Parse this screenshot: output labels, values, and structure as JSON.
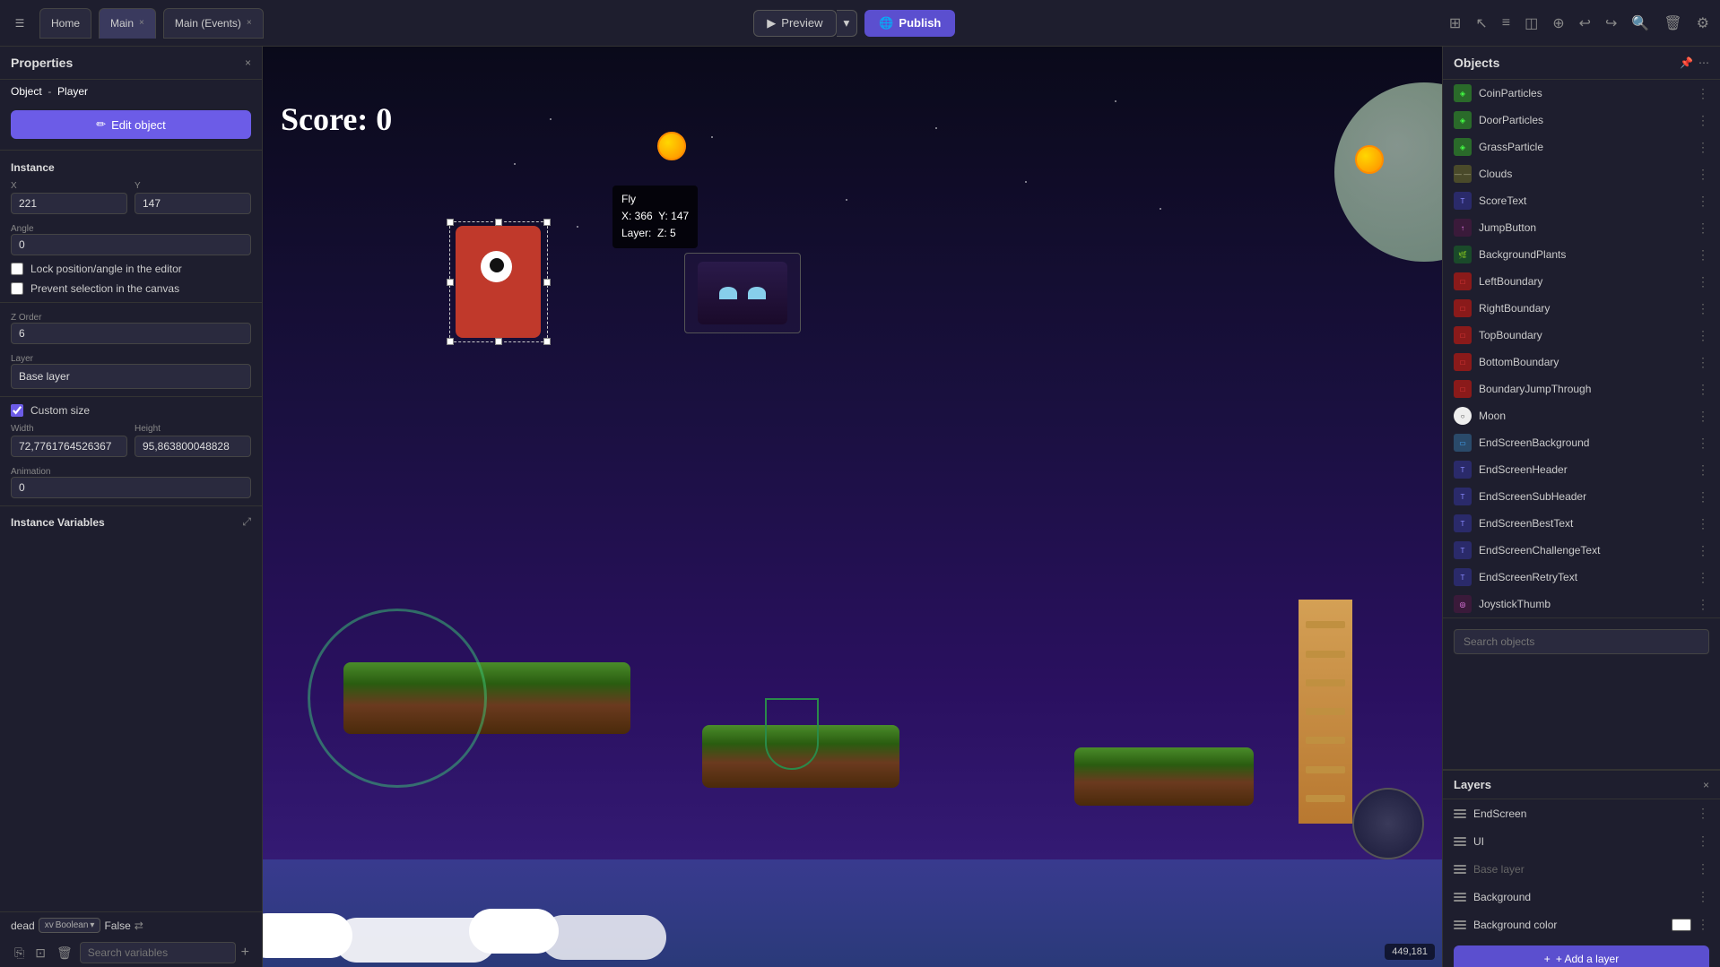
{
  "app": {
    "menu_icon": "☰",
    "tabs": [
      {
        "label": "Home",
        "closable": false,
        "active": false
      },
      {
        "label": "Main",
        "closable": true,
        "active": true
      },
      {
        "label": "Main (Events)",
        "closable": true,
        "active": false
      }
    ]
  },
  "toolbar": {
    "preview_label": "Preview",
    "preview_dropdown": "▾",
    "publish_label": "Publish",
    "icons": [
      "grid",
      "select",
      "list",
      "layers",
      "crosshair",
      "undo",
      "redo",
      "search",
      "trash",
      "settings"
    ]
  },
  "properties": {
    "title": "Properties",
    "object_prefix": "Object",
    "object_name": "Player",
    "edit_button": "Edit object",
    "instance_label": "Instance",
    "x_label": "X",
    "x_value": "221",
    "y_label": "Y",
    "y_value": "147",
    "angle_label": "Angle",
    "angle_value": "0",
    "lock_label": "Lock position/angle in the editor",
    "prevent_label": "Prevent selection in the canvas",
    "zorder_label": "Z Order",
    "zorder_value": "6",
    "layer_label": "Layer",
    "layer_value": "Base layer",
    "custom_size_label": "Custom size",
    "custom_size_checked": true,
    "width_label": "Width",
    "width_value": "72,7761764526367",
    "height_label": "Height",
    "height_value": "95,863800048828",
    "animation_label": "Animation",
    "animation_value": "0",
    "instance_vars_label": "Instance Variables",
    "var_name": "dead",
    "var_type": "Boolean",
    "var_value": "False",
    "search_vars_placeholder": "Search variables",
    "add_var_icon": "+"
  },
  "canvas": {
    "score": "Score: 0",
    "fly_popup": {
      "name": "Fly",
      "x": "X: 366",
      "y": "Y: 147",
      "layer": "Layer:",
      "z": "Z: 5"
    },
    "coords": "449,181"
  },
  "objects_panel": {
    "title": "Objects",
    "search_placeholder": "Search objects",
    "items": [
      {
        "name": "CoinParticles",
        "icon_type": "particle"
      },
      {
        "name": "DoorParticles",
        "icon_type": "particle"
      },
      {
        "name": "GrassParticle",
        "icon_type": "particle"
      },
      {
        "name": "Clouds",
        "icon_type": "dash"
      },
      {
        "name": "ScoreText",
        "icon_type": "text"
      },
      {
        "name": "JumpButton",
        "icon_type": "jump"
      },
      {
        "name": "BackgroundPlants",
        "icon_type": "plant"
      },
      {
        "name": "LeftBoundary",
        "icon_type": "boundary"
      },
      {
        "name": "RightBoundary",
        "icon_type": "boundary"
      },
      {
        "name": "TopBoundary",
        "icon_type": "boundary"
      },
      {
        "name": "BottomBoundary",
        "icon_type": "boundary"
      },
      {
        "name": "BoundaryJumpThrough",
        "icon_type": "boundary"
      },
      {
        "name": "Moon",
        "icon_type": "moon"
      },
      {
        "name": "EndScreenBackground",
        "icon_type": "end"
      },
      {
        "name": "EndScreenHeader",
        "icon_type": "text"
      },
      {
        "name": "EndScreenSubHeader",
        "icon_type": "text"
      },
      {
        "name": "EndScreenBestText",
        "icon_type": "text"
      },
      {
        "name": "EndScreenChallengeText",
        "icon_type": "text"
      },
      {
        "name": "EndScreenRetryText",
        "icon_type": "text"
      },
      {
        "name": "JoystickThumb",
        "icon_type": "jump"
      }
    ]
  },
  "layers_panel": {
    "title": "Layers",
    "close_icon": "×",
    "items": [
      {
        "name": "EndScreen",
        "dim": false
      },
      {
        "name": "UI",
        "dim": false
      },
      {
        "name": "Base layer",
        "dim": true
      },
      {
        "name": "Background",
        "dim": false
      },
      {
        "name": "Background color",
        "has_swatch": true,
        "swatch_color": "#ffffff"
      }
    ],
    "add_layer_btn": "+ Add a layer"
  }
}
